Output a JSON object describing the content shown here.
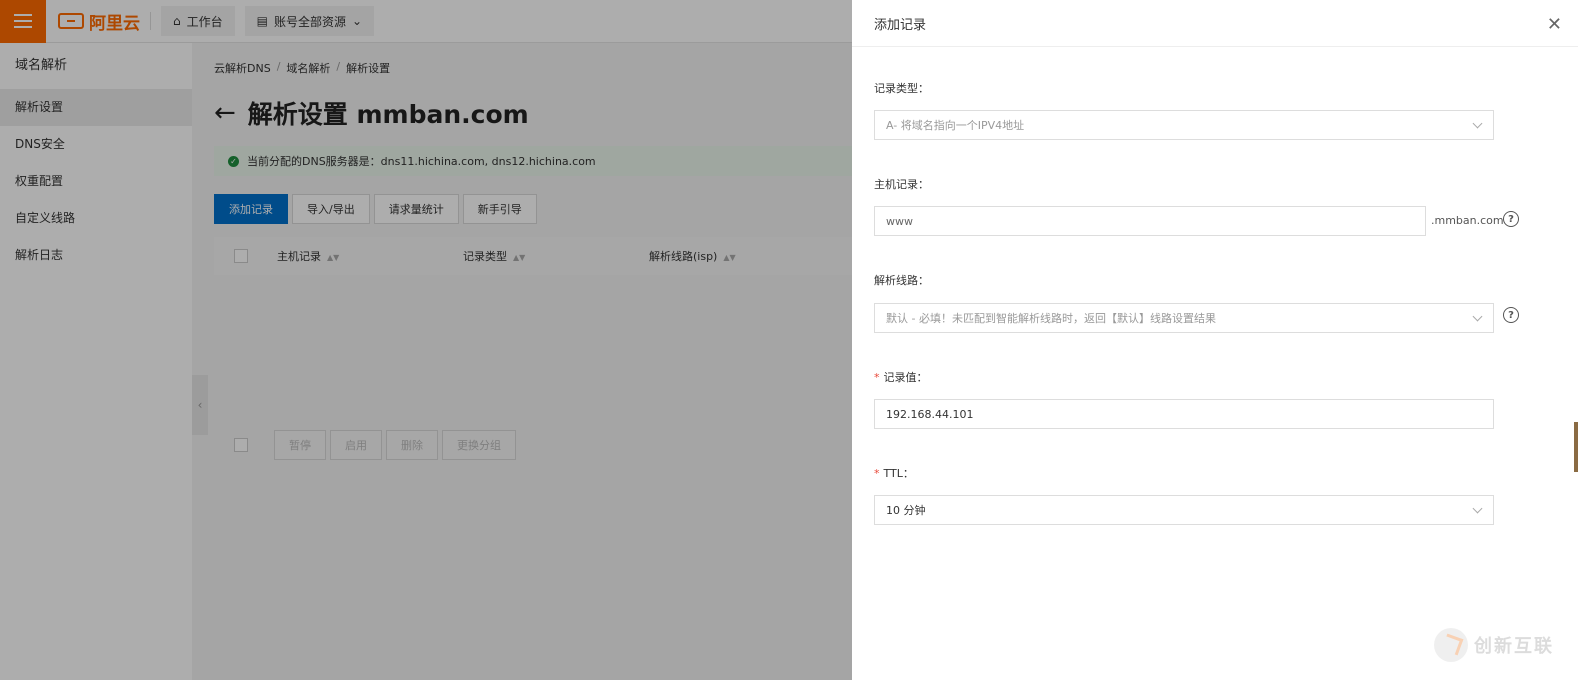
{
  "topbar": {
    "logo_text": "阿里云",
    "workbench_label": "工作台",
    "resources_label": "账号全部资源"
  },
  "sidebar": {
    "title": "域名解析",
    "items": [
      {
        "label": "解析设置"
      },
      {
        "label": "DNS安全"
      },
      {
        "label": "权重配置"
      },
      {
        "label": "自定义线路"
      },
      {
        "label": "解析日志"
      }
    ]
  },
  "main": {
    "breadcrumb": [
      "云解析DNS",
      "域名解析",
      "解析设置"
    ],
    "title": "解析设置 mmban.com",
    "alert_text": "当前分配的DNS服务器是：dns11.hichina.com, dns12.hichina.com",
    "toolbar": {
      "add": "添加记录",
      "import_export": "导入/导出",
      "stats": "请求量统计",
      "guide": "新手引导"
    },
    "table_headers": [
      "主机记录",
      "记录类型",
      "解析线路(isp)"
    ],
    "footer_buttons": [
      "暂停",
      "启用",
      "删除",
      "更换分组"
    ]
  },
  "drawer": {
    "title": "添加记录",
    "record_type": {
      "label": "记录类型：",
      "placeholder": "A- 将域名指向一个IPV4地址"
    },
    "host": {
      "label": "主机记录：",
      "value": "www",
      "suffix": ".mmban.com"
    },
    "line": {
      "label": "解析线路：",
      "placeholder": "默认 - 必填！未匹配到智能解析线路时，返回【默认】线路设置结果"
    },
    "value": {
      "label": "记录值：",
      "value": "192.168.44.101"
    },
    "ttl": {
      "label": "TTL：",
      "value": "10 分钟"
    }
  },
  "watermark": {
    "text": "创新互联"
  },
  "colors": {
    "brand": "#ff6a00",
    "primary": "#0070cc",
    "required": "#e84738"
  }
}
